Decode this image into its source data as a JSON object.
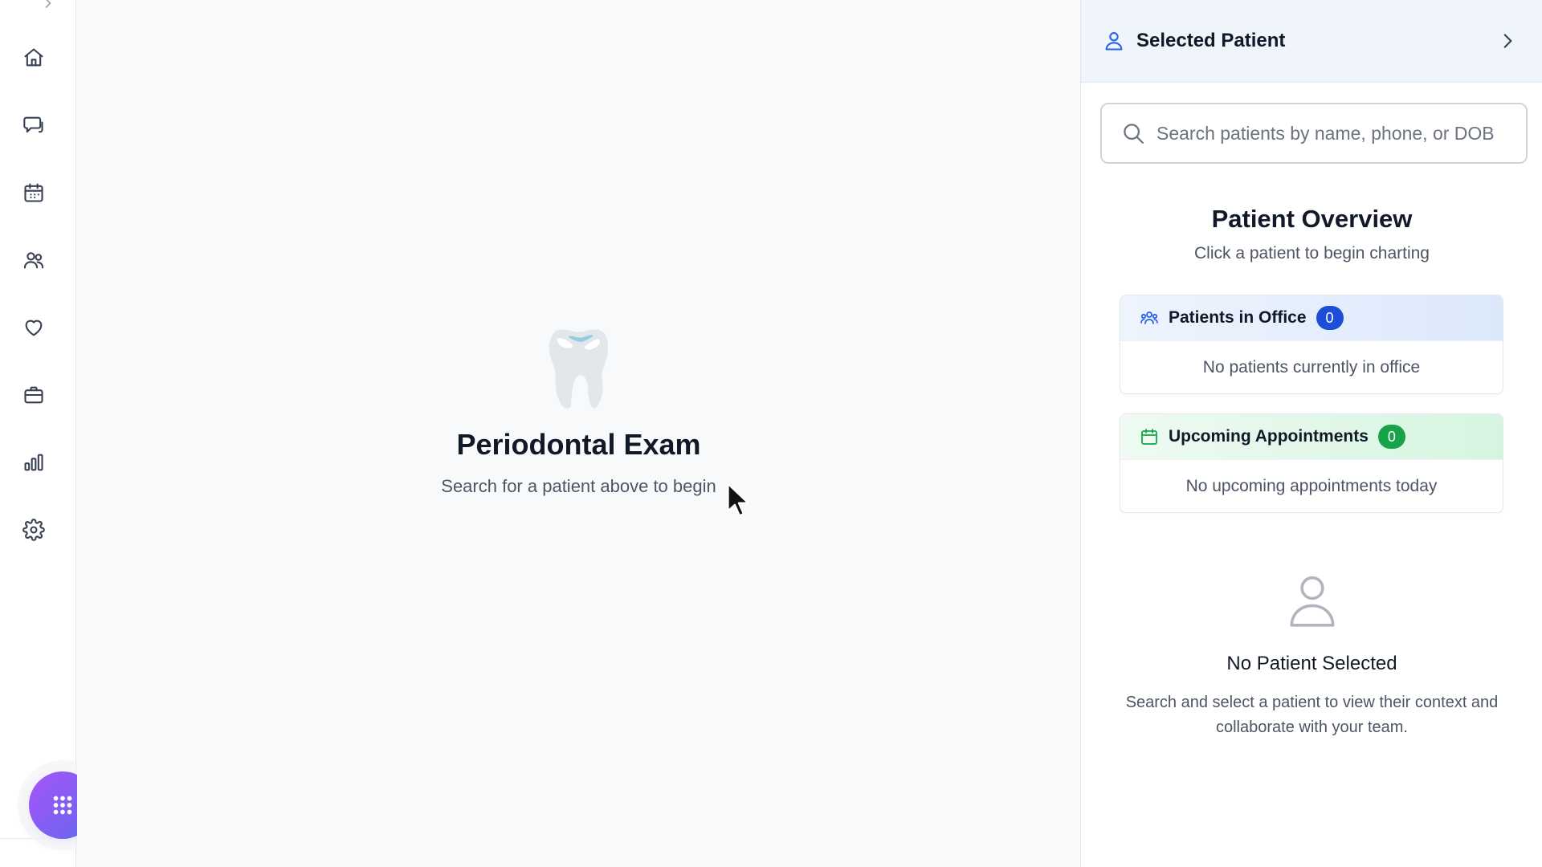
{
  "sidebar": {
    "items": [
      {
        "icon": "home-icon",
        "label": "Home"
      },
      {
        "icon": "chat-icon",
        "label": "Messages"
      },
      {
        "icon": "calendar-icon",
        "label": "Schedule"
      },
      {
        "icon": "users-icon",
        "label": "Patients"
      },
      {
        "icon": "heart-icon",
        "label": "Health"
      },
      {
        "icon": "briefcase-icon",
        "label": "Business"
      },
      {
        "icon": "bar-chart-icon",
        "label": "Reports"
      },
      {
        "icon": "gear-icon",
        "label": "Settings"
      }
    ],
    "fab_icon": "apps-grid-icon"
  },
  "main": {
    "emoji": "🦷",
    "title": "Periodontal Exam",
    "subtitle": "Search for a patient above to begin"
  },
  "panel": {
    "header_title": "Selected Patient",
    "search": {
      "placeholder": "Search patients by name, phone, or DOB",
      "value": ""
    },
    "overview_title": "Patient Overview",
    "overview_subtitle": "Click a patient to begin charting",
    "in_office": {
      "label": "Patients in Office",
      "count": "0",
      "empty_text": "No patients currently in office"
    },
    "upcoming": {
      "label": "Upcoming Appointments",
      "count": "0",
      "empty_text": "No upcoming appointments today"
    },
    "no_patient": {
      "title": "No Patient Selected",
      "description": "Search and select a patient to view their context and collaborate with your team."
    }
  },
  "colors": {
    "accent_blue": "#2563eb",
    "accent_green": "#16a34a",
    "fab_gradient_start": "#a855f7",
    "fab_gradient_end": "#6366f1"
  }
}
